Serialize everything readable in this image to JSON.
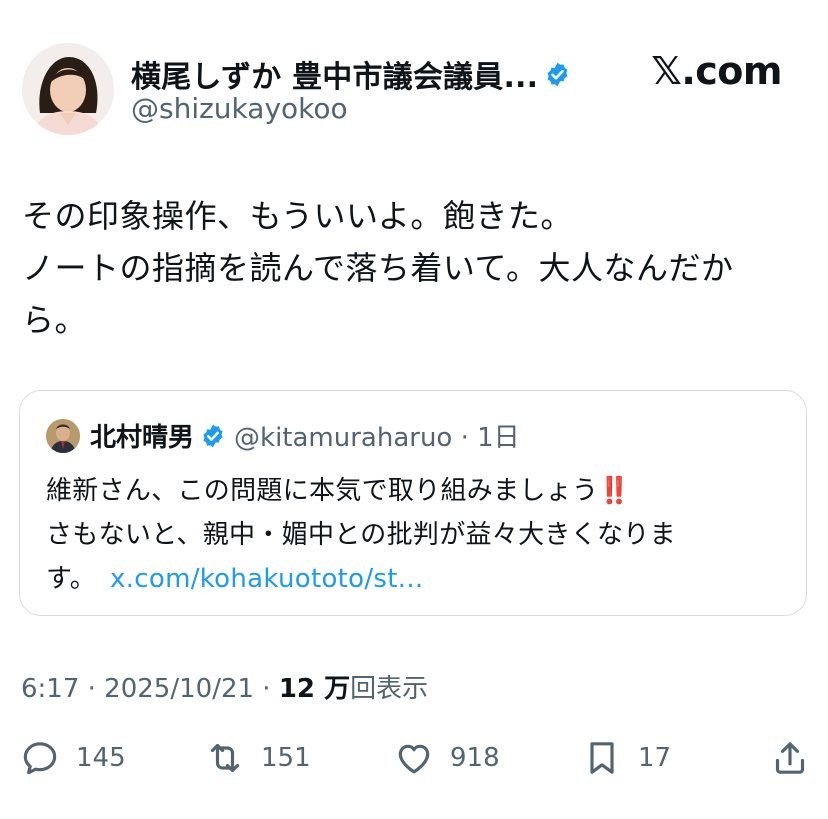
{
  "author": {
    "display_name": "横尾しずか 豊中市議会議員...",
    "handle": "@shizukayokoo",
    "verified": true
  },
  "brand": "𝕏.com",
  "tweet": {
    "lines": [
      "その印象操作、もういいよ。飽きた。",
      "ノートの指摘を読んで落ち着いて。大人なんだか",
      "ら。"
    ]
  },
  "quote": {
    "display_name": "北村晴男",
    "handle_time": "@kitamuraharuo · 1日",
    "verified": true,
    "line1": "維新さん、この問題に本気で取り組みましょう",
    "line1_emoji": "‼️",
    "line2": "さもないと、親中・媚中との批判が益々大きくなりま",
    "line3": "す。",
    "link": "x.com/kohakuototo/st..."
  },
  "meta": {
    "time_date": "6:17 · 2025/10/21 · ",
    "views_count": "12 万",
    "views_label": "回表示"
  },
  "actions": {
    "replies": "145",
    "reposts": "151",
    "likes": "918",
    "bookmarks": "17"
  },
  "colors": {
    "verified_badge": "#1d9bf0",
    "link": "#1d9bf0",
    "secondary_text": "#536471"
  }
}
